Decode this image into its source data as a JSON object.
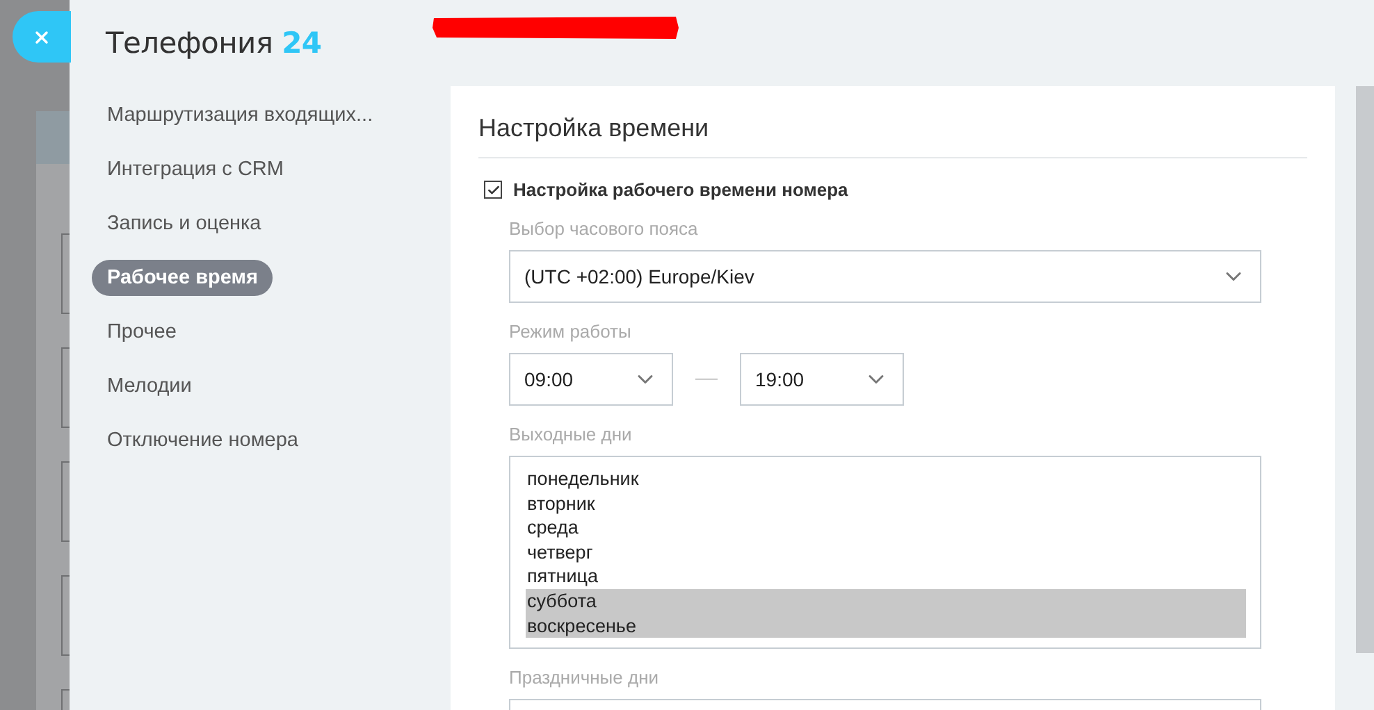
{
  "header": {
    "title": "Телефония",
    "title_accent": "24"
  },
  "sidebar": {
    "items": [
      {
        "label": "Маршрутизация входящих...",
        "selected": false
      },
      {
        "label": "Интеграция с CRM",
        "selected": false
      },
      {
        "label": "Запись и оценка",
        "selected": false
      },
      {
        "label": "Рабочее время",
        "selected": true
      },
      {
        "label": "Прочее",
        "selected": false
      },
      {
        "label": "Мелодии",
        "selected": false
      },
      {
        "label": "Отключение номера",
        "selected": false
      }
    ]
  },
  "section": {
    "title": "Настройка времени",
    "enable": {
      "label": "Настройка рабочего времени номера",
      "checked": true
    },
    "timezone": {
      "label": "Выбор часового пояса",
      "value": "(UTC +02:00) Europe/Kiev"
    },
    "work_hours": {
      "label": "Режим работы",
      "from": "09:00",
      "separator": "—",
      "to": "19:00"
    },
    "weekends": {
      "label": "Выходные дни",
      "options": [
        {
          "label": "понедельник",
          "selected": false
        },
        {
          "label": "вторник",
          "selected": false
        },
        {
          "label": "среда",
          "selected": false
        },
        {
          "label": "четверг",
          "selected": false
        },
        {
          "label": "пятница",
          "selected": false
        },
        {
          "label": "суббота",
          "selected": true
        },
        {
          "label": "воскресенье",
          "selected": true
        }
      ]
    },
    "holidays": {
      "label": "Праздничные дни"
    }
  }
}
